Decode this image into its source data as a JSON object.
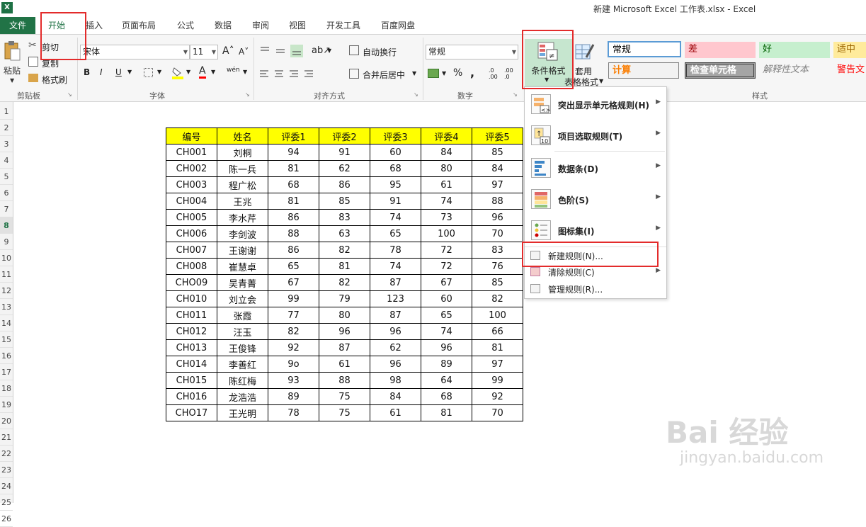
{
  "window": {
    "app_icon": "X",
    "title": "新建 Microsoft Excel 工作表.xlsx - Excel"
  },
  "tabs": [
    "文件",
    "开始",
    "插入",
    "页面布局",
    "公式",
    "数据",
    "审阅",
    "视图",
    "开发工具",
    "百度网盘"
  ],
  "ribbon": {
    "clipboard": {
      "paste": "粘贴",
      "cut": "剪切",
      "copy": "复制",
      "format_painter": "格式刷",
      "label": "剪贴板"
    },
    "font": {
      "font_name": "宋体",
      "font_size": "11",
      "bold": "B",
      "italic": "I",
      "underline": "U",
      "font_color": "A",
      "phonetic": "wén",
      "label": "字体"
    },
    "alignment": {
      "wrap_text": "自动换行",
      "merge_center": "合并后居中",
      "label": "对齐方式"
    },
    "number": {
      "format": "常规",
      "percent": "%",
      "comma": ",",
      "inc_decimal": ".0 .00",
      "dec_decimal": ".00 .0",
      "label": "数字"
    },
    "styles": {
      "conditional_format": "条件格式",
      "table_format": [
        "套用",
        "表格格式"
      ],
      "cells": [
        {
          "text": "常规",
          "bg": "#ffffff",
          "color": "#000000"
        },
        {
          "text": "差",
          "bg": "#ffc7ce",
          "color": "#9c0006"
        },
        {
          "text": "好",
          "bg": "#c6efce",
          "color": "#006100"
        },
        {
          "text": "适中",
          "bg": "#ffeb9c",
          "color": "#9c6500"
        },
        {
          "text": "计算",
          "bg": "#f2f2f2",
          "color": "#fa7d00"
        },
        {
          "text": "检查单元格",
          "bg": "#a5a5a5",
          "color": "#ffffff"
        },
        {
          "text": "解释性文本",
          "bg": "#f6f6f6",
          "color": "#7f7f7f"
        },
        {
          "text": "警告文",
          "bg": "#f6f6f6",
          "color": "#ff0000"
        }
      ],
      "label": "样式"
    }
  },
  "row_numbers": [
    "1",
    "2",
    "3",
    "4",
    "5",
    "6",
    "7",
    "8",
    "9",
    "10",
    "11",
    "12",
    "13",
    "14",
    "15",
    "16",
    "17",
    "18",
    "19",
    "20",
    "21",
    "22",
    "23",
    "24",
    "25",
    "26"
  ],
  "active_row": "8",
  "table": {
    "headers": [
      "编号",
      "姓名",
      "评委1",
      "评委2",
      "评委3",
      "评委4",
      "评委5"
    ],
    "rows": [
      [
        "CH001",
        "刘桐",
        "94",
        "91",
        "60",
        "84",
        "85"
      ],
      [
        "CH002",
        "陈一兵",
        "81",
        "62",
        "68",
        "80",
        "84"
      ],
      [
        "CH003",
        "程广松",
        "68",
        "86",
        "95",
        "61",
        "97"
      ],
      [
        "CH004",
        "王兆",
        "81",
        "85",
        "91",
        "74",
        "88"
      ],
      [
        "CH005",
        "李水芹",
        "86",
        "83",
        "74",
        "73",
        "96"
      ],
      [
        "CH006",
        "李剑波",
        "88",
        "63",
        "65",
        "100",
        "70"
      ],
      [
        "CH007",
        "王谢谢",
        "86",
        "82",
        "78",
        "72",
        "83"
      ],
      [
        "CH008",
        "崔慧卓",
        "65",
        "81",
        "74",
        "72",
        "76"
      ],
      [
        "CHO09",
        "吴青菁",
        "67",
        "82",
        "87",
        "67",
        "85"
      ],
      [
        "CH010",
        "刘立会",
        "99",
        "79",
        "123",
        "60",
        "82"
      ],
      [
        "CH011",
        "张霞",
        "77",
        "80",
        "87",
        "65",
        "100"
      ],
      [
        "CH012",
        "汪玉",
        "82",
        "96",
        "96",
        "74",
        "66"
      ],
      [
        "CH013",
        "王俊锋",
        "92",
        "87",
        "62",
        "96",
        "81"
      ],
      [
        "CH014",
        "李善红",
        "9o",
        "61",
        "96",
        "89",
        "97"
      ],
      [
        "CH015",
        "陈红梅",
        "93",
        "88",
        "98",
        "64",
        "99"
      ],
      [
        "CH016",
        "龙浩浩",
        "89",
        "75",
        "84",
        "68",
        "92"
      ],
      [
        "CHO17",
        "王光明",
        "78",
        "75",
        "61",
        "81",
        "70"
      ]
    ]
  },
  "menu": {
    "items": [
      {
        "label": "突出显示单元格规则(H)",
        "icon": "highlight-rules-icon",
        "submenu": "▶"
      },
      {
        "label": "项目选取规则(T)",
        "icon": "top-bottom-rules-icon",
        "submenu": "▶"
      },
      {
        "label": "数据条(D)",
        "icon": "data-bars-icon",
        "submenu": "▶"
      },
      {
        "label": "色阶(S)",
        "icon": "color-scales-icon",
        "submenu": "▶"
      },
      {
        "label": "图标集(I)",
        "icon": "icon-sets-icon",
        "submenu": "▶"
      }
    ],
    "small_items": [
      {
        "label": "新建规则(N)...",
        "icon": "new-rule-icon"
      },
      {
        "label": "清除规则(C)",
        "icon": "clear-rules-icon",
        "submenu": "▶"
      },
      {
        "label": "管理规则(R)...",
        "icon": "manage-rules-icon"
      }
    ]
  },
  "watermark": {
    "main": "Bai 经验",
    "sub": "jingyan.baidu.com"
  },
  "colors": {
    "excel_green": "#217346",
    "highlight_red": "#e32b2b",
    "header_yellow": "#ffff00"
  }
}
